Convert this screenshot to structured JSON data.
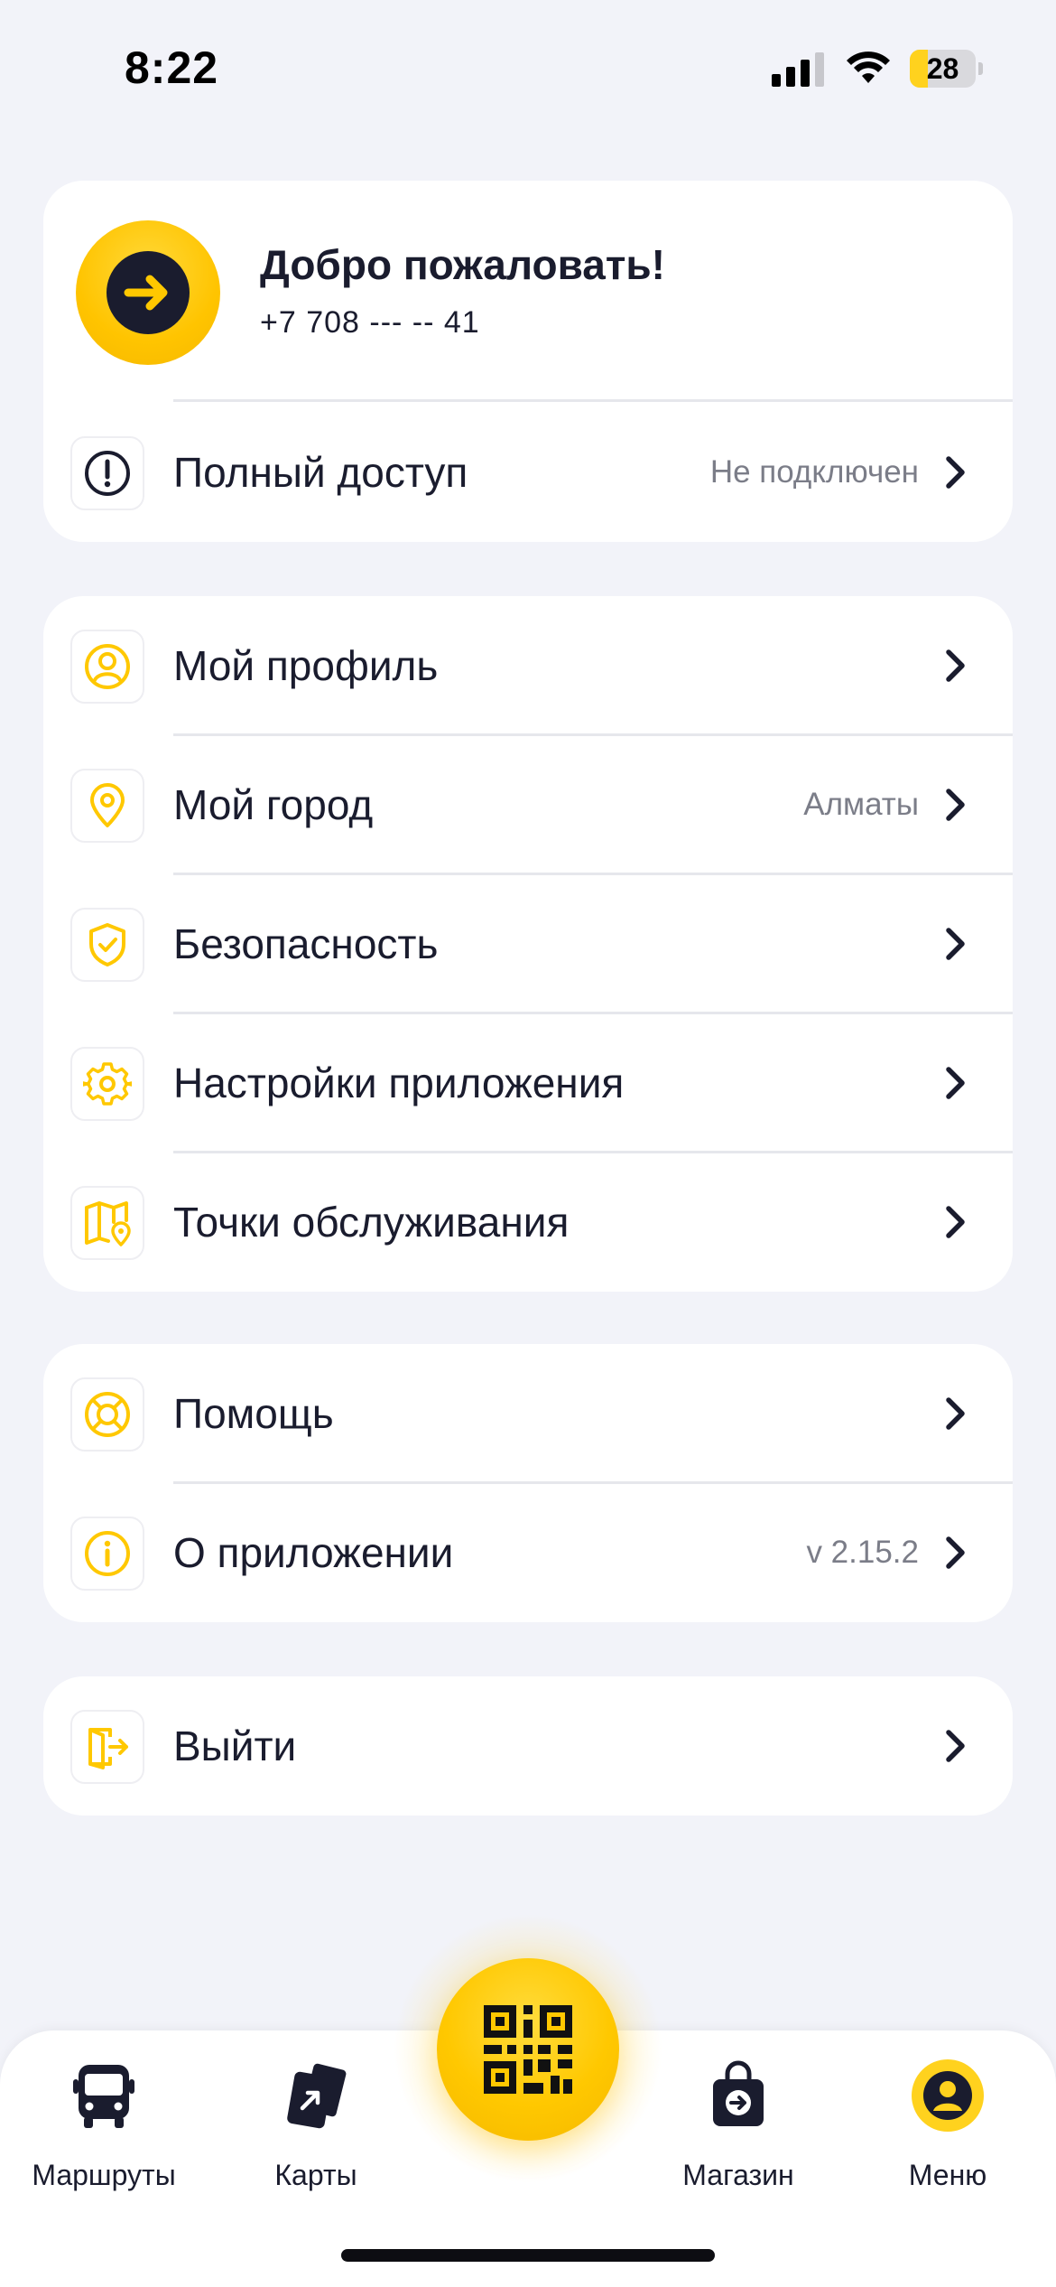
{
  "status_bar": {
    "time": "8:22",
    "battery_level": "28",
    "battery_fraction": 0.28
  },
  "welcome": {
    "title": "Добро пожаловать!",
    "phone": "+7 708 --- -- 41",
    "avatar_icon": "arrow-right-circle-icon",
    "full_access": {
      "label": "Полный доступ",
      "value": "Не подключен",
      "icon": "alert-circle-icon"
    }
  },
  "main_menu": {
    "items": [
      {
        "label": "Мой профиль",
        "value": "",
        "icon": "user-circle-icon"
      },
      {
        "label": "Мой город",
        "value": "Алматы",
        "icon": "map-pin-icon"
      },
      {
        "label": "Безопасность",
        "value": "",
        "icon": "shield-check-icon"
      },
      {
        "label": "Настройки приложения",
        "value": "",
        "icon": "gear-icon"
      },
      {
        "label": "Точки обслуживания",
        "value": "",
        "icon": "map-location-icon"
      }
    ]
  },
  "help_menu": {
    "items": [
      {
        "label": "Помощь",
        "value": "",
        "icon": "lifebuoy-icon"
      },
      {
        "label": "О приложении",
        "value": "v 2.15.2",
        "icon": "info-circle-icon"
      }
    ]
  },
  "exit_menu": {
    "label": "Выйти",
    "icon": "logout-icon"
  },
  "bottom_nav": {
    "routes": "Маршруты",
    "cards": "Карты",
    "qr_icon": "qr-code-icon",
    "shop": "Магазин",
    "menu": "Меню",
    "active": "Меню"
  },
  "colors": {
    "accent": "#ffc800",
    "background": "#f2f3f9",
    "text": "#1a1c2e",
    "muted": "#7b7d88"
  }
}
